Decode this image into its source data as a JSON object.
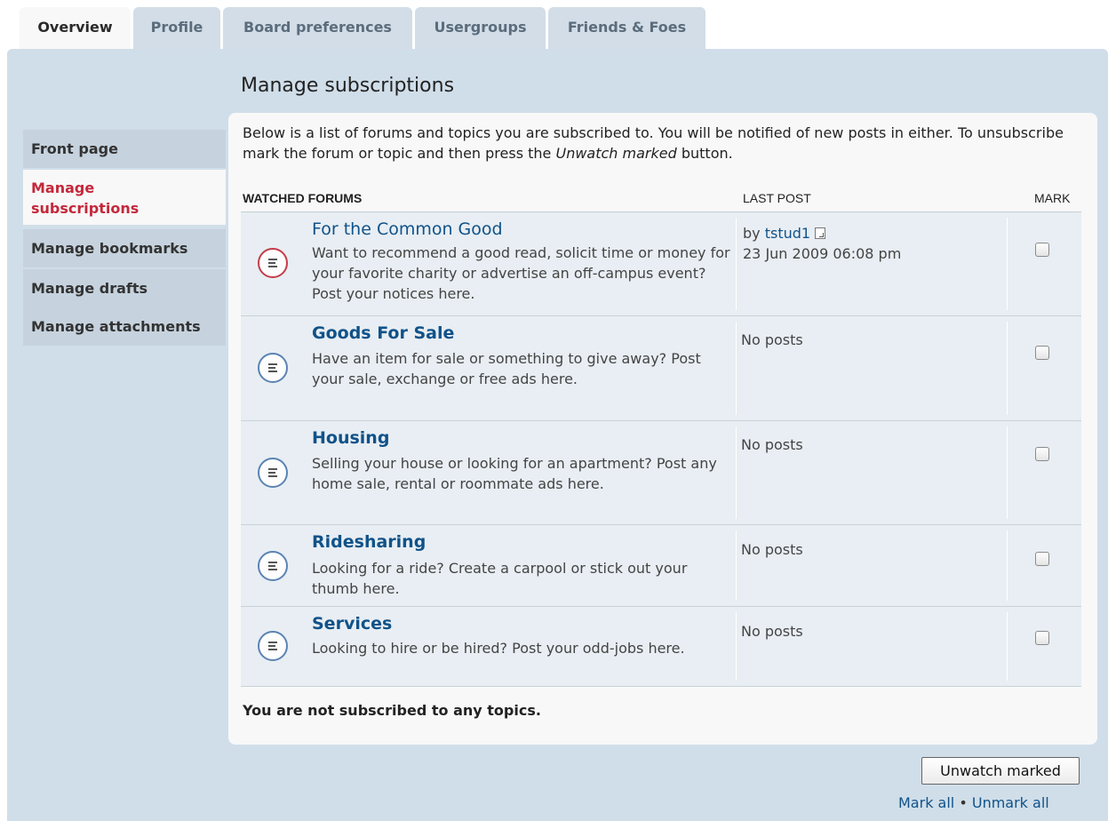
{
  "tabs": [
    "Overview",
    "Profile",
    "Board preferences",
    "Usergroups",
    "Friends & Foes"
  ],
  "menu": [
    {
      "label": "Front page"
    },
    {
      "label": "Manage subscriptions",
      "lines": [
        "Manage",
        "subscriptions"
      ]
    },
    {
      "label": "Manage bookmarks"
    },
    {
      "label": "Manage drafts"
    },
    {
      "label": "Manage attachments"
    }
  ],
  "page_title": "Manage subscriptions",
  "intro_text_1": "Below is a list of forums and topics you are subscribed to. You will be notified of new posts in either. To unsubscribe mark the forum or topic and then press the ",
  "intro_em": "Unwatch marked",
  "intro_text_2": " button.",
  "columns": {
    "forums": "WATCHED FORUMS",
    "last_post": "LAST POST",
    "mark": "MARK"
  },
  "forums": [
    {
      "title": "For the Common Good",
      "desc": "Want to recommend a good read, solicit time or money for your favorite charity or advertise an off-campus event? Post your notices here.",
      "last_post": {
        "by": "by",
        "author": "tstud1",
        "date": "23 Jun 2009 06:08 pm"
      },
      "unread": true
    },
    {
      "title": "Goods For Sale",
      "desc": "Have an item for sale or something to give away? Post your sale, exchange or free ads here.",
      "last_post_text": "No posts"
    },
    {
      "title": "Housing",
      "desc": "Selling your house or looking for an apartment? Post any home sale, rental or roommate ads here.",
      "last_post_text": "No posts"
    },
    {
      "title": "Ridesharing",
      "desc": "Looking for a ride? Create a carpool or stick out your thumb here.",
      "last_post_text": "No posts"
    },
    {
      "title": "Services",
      "desc": "Looking to hire or be hired? Post your odd-jobs here.",
      "last_post_text": "No posts"
    }
  ],
  "no_topics": "You are not subscribed to any topics.",
  "unwatch_button": "Unwatch marked",
  "mark_all": "Mark all",
  "separator": "•",
  "unmark_all": "Unmark all"
}
